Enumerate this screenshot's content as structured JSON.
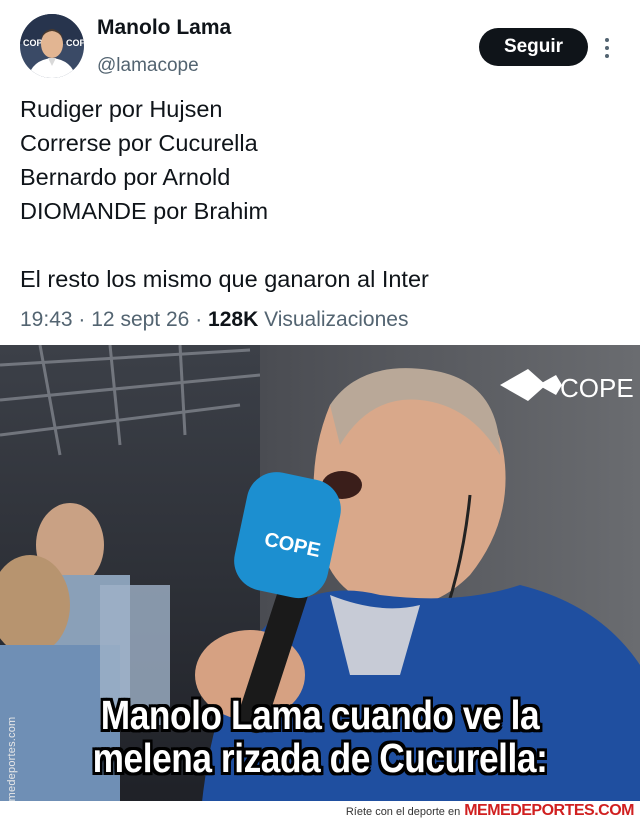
{
  "tweet": {
    "author_name": "Manolo Lama",
    "author_handle": "@lamacope",
    "follow_label": "Seguir",
    "lines": [
      "Rudiger por Hujsen",
      "Correrse por Cucurella",
      "Bernardo por Arnold",
      "DIOMANDE por Brahim",
      "El resto los mismo que ganaron al Inter"
    ],
    "time": "19:43",
    "date": "12 sept 26",
    "views_count": "128K",
    "views_label": "Visualizaciones"
  },
  "meme": {
    "logo_text": "COPE",
    "mic_text": "COPE",
    "side_watermark": "Memedeportes.com",
    "caption_line1": "Manolo Lama cuando ve la",
    "caption_line2": "melena rizada de Cucurella:",
    "footer_text": "Ríete con el deporte en",
    "footer_brand": "MEMEDEPORTES.COM"
  },
  "colors": {
    "follow_bg": "#0f1419",
    "meta_gray": "#536471",
    "mic_blue": "#1c8fd0",
    "jacket_blue": "#1f4fa0"
  }
}
